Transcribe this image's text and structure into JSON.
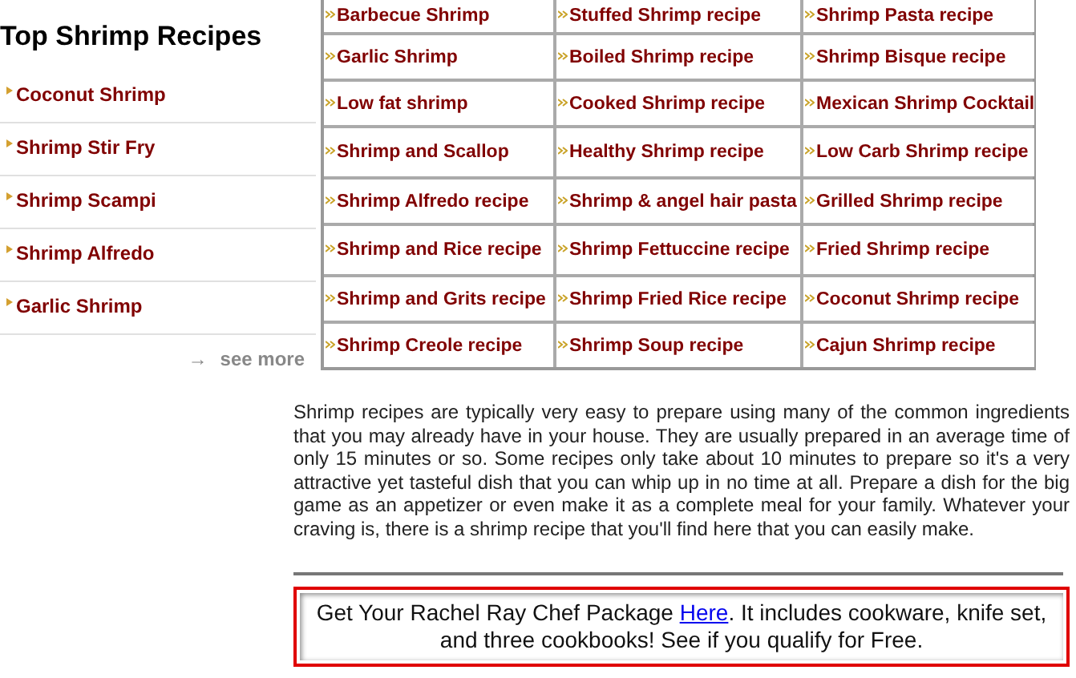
{
  "sidebar": {
    "title": "Top Shrimp Recipes",
    "items": [
      "Coconut Shrimp",
      "Shrimp Stir Fry",
      "Shrimp Scampi",
      "Shrimp Alfredo",
      "Garlic Shrimp"
    ],
    "see_more": {
      "arrow": "→",
      "label": "see more"
    }
  },
  "recipe_table": {
    "rows": [
      [
        "Barbecue Shrimp",
        "Stuffed Shrimp recipe",
        "Shrimp Pasta recipe"
      ],
      [
        "Garlic Shrimp",
        "Boiled Shrimp recipe",
        "Shrimp Bisque recipe"
      ],
      [
        "Low fat shrimp",
        "Cooked Shrimp recipe",
        "Mexican Shrimp Cocktail"
      ],
      [
        "Shrimp and Scallop",
        "Healthy Shrimp recipe",
        "Low Carb Shrimp recipe"
      ],
      [
        "Shrimp Alfredo recipe",
        "Shrimp & angel hair pasta",
        "Grilled Shrimp recipe"
      ],
      [
        "Shrimp and Rice recipe",
        "Shrimp Fettuccine recipe",
        "Fried Shrimp recipe"
      ],
      [
        "Shrimp and Grits recipe",
        "Shrimp Fried Rice recipe",
        "Coconut Shrimp recipe"
      ],
      [
        "Shrimp Creole recipe",
        "Shrimp Soup recipe",
        "Cajun Shrimp recipe"
      ]
    ]
  },
  "description": "Shrimp recipes are typically very easy to prepare using many of the common ingredients that you may already have in your house.  They are usually prepared in an average time of only 15 minutes or so.  Some recipes only take about 10 minutes to prepare so it's a very attractive yet tasteful dish that you can whip up in no time at all.  Prepare a dish for the big game as an appetizer or even make it as a complete meal for your family.  Whatever your craving is, there is a shrimp recipe that you'll find here that you can easily make.",
  "promo": {
    "before": "Get Your Rachel Ray Chef Package ",
    "link": "Here",
    "after": ".  It includes cookware, knife set, and three cookbooks! See if you qualify for Free."
  }
}
